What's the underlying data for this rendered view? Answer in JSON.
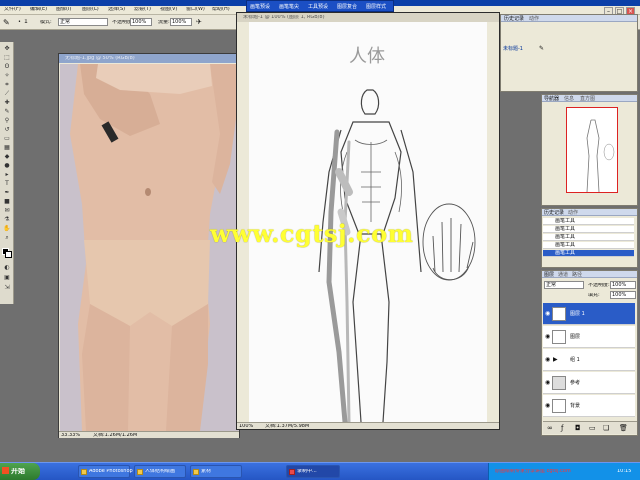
{
  "menu": {
    "items": [
      "文件(F)",
      "编辑(E)",
      "图像(I)",
      "图层(L)",
      "选择(S)",
      "滤镜(T)",
      "视图(V)",
      "窗口(W)",
      "帮助(H)"
    ]
  },
  "options": {
    "brush_size": "1",
    "mode_label": "模式:",
    "mode_value": "正常",
    "opacity_label": "不透明度:",
    "opacity_value": "100%",
    "flow_label": "流量:",
    "flow_value": "100%"
  },
  "toolbar2": {
    "items": [
      "画笔预设",
      "画笔笔尖",
      "工具预设",
      "图层复合",
      "图层样式"
    ]
  },
  "photo_window": {
    "title": "无标题-1.jpg @ 50% (RGB/8)",
    "zoom": "33.33%",
    "doc_info": "文档:1.26M/1.26M"
  },
  "draw_window": {
    "title": "未标题-1 @ 100% (图层 1, RGB/8)",
    "zoom": "100%",
    "doc_info": "文档:1.37M/5.98M",
    "heading": "人体"
  },
  "watermark": "www.cgtsj.com",
  "history_panel": {
    "tabs": [
      "历史记录",
      "动作"
    ],
    "snapshot": "未标题-1"
  },
  "navigator_panel": {
    "tabs": [
      "导航器",
      "信息",
      "直方图"
    ]
  },
  "history_list": {
    "tabs": [
      "历史记录",
      "动作"
    ],
    "items": [
      "画笔工具",
      "画笔工具",
      "画笔工具",
      "画笔工具",
      "画笔工具"
    ]
  },
  "layers_panel": {
    "tabs": [
      "图层",
      "通道",
      "路径"
    ],
    "blend_mode": "正常",
    "opacity_label": "不透明度:",
    "opacity_value": "100%",
    "fill_label": "填充:",
    "fill_value": "100%",
    "layers": [
      {
        "name": "图层 1",
        "selected": true
      },
      {
        "name": "图层",
        "selected": false
      },
      {
        "name": "组 1",
        "selected": false
      },
      {
        "name": "参考",
        "selected": false
      },
      {
        "name": "背景",
        "selected": false
      }
    ]
  },
  "taskbar": {
    "start_label": "开始",
    "tasks": [
      {
        "label": "Adobe Photoshop",
        "active": false
      },
      {
        "label": "人体结构绘画",
        "active": false
      },
      {
        "label": "素材",
        "active": false
      },
      {
        "label": "录制中...",
        "active": true
      }
    ],
    "tray_text": "原画绘制专家分享讲座 cgtsj.com",
    "clock": "10:15"
  },
  "colors": {
    "title_blue": "#0b3fa8",
    "selection_blue": "#2a5cc7",
    "watermark_yellow": "#ffff33",
    "taskbar_blue": "#2556c4"
  }
}
